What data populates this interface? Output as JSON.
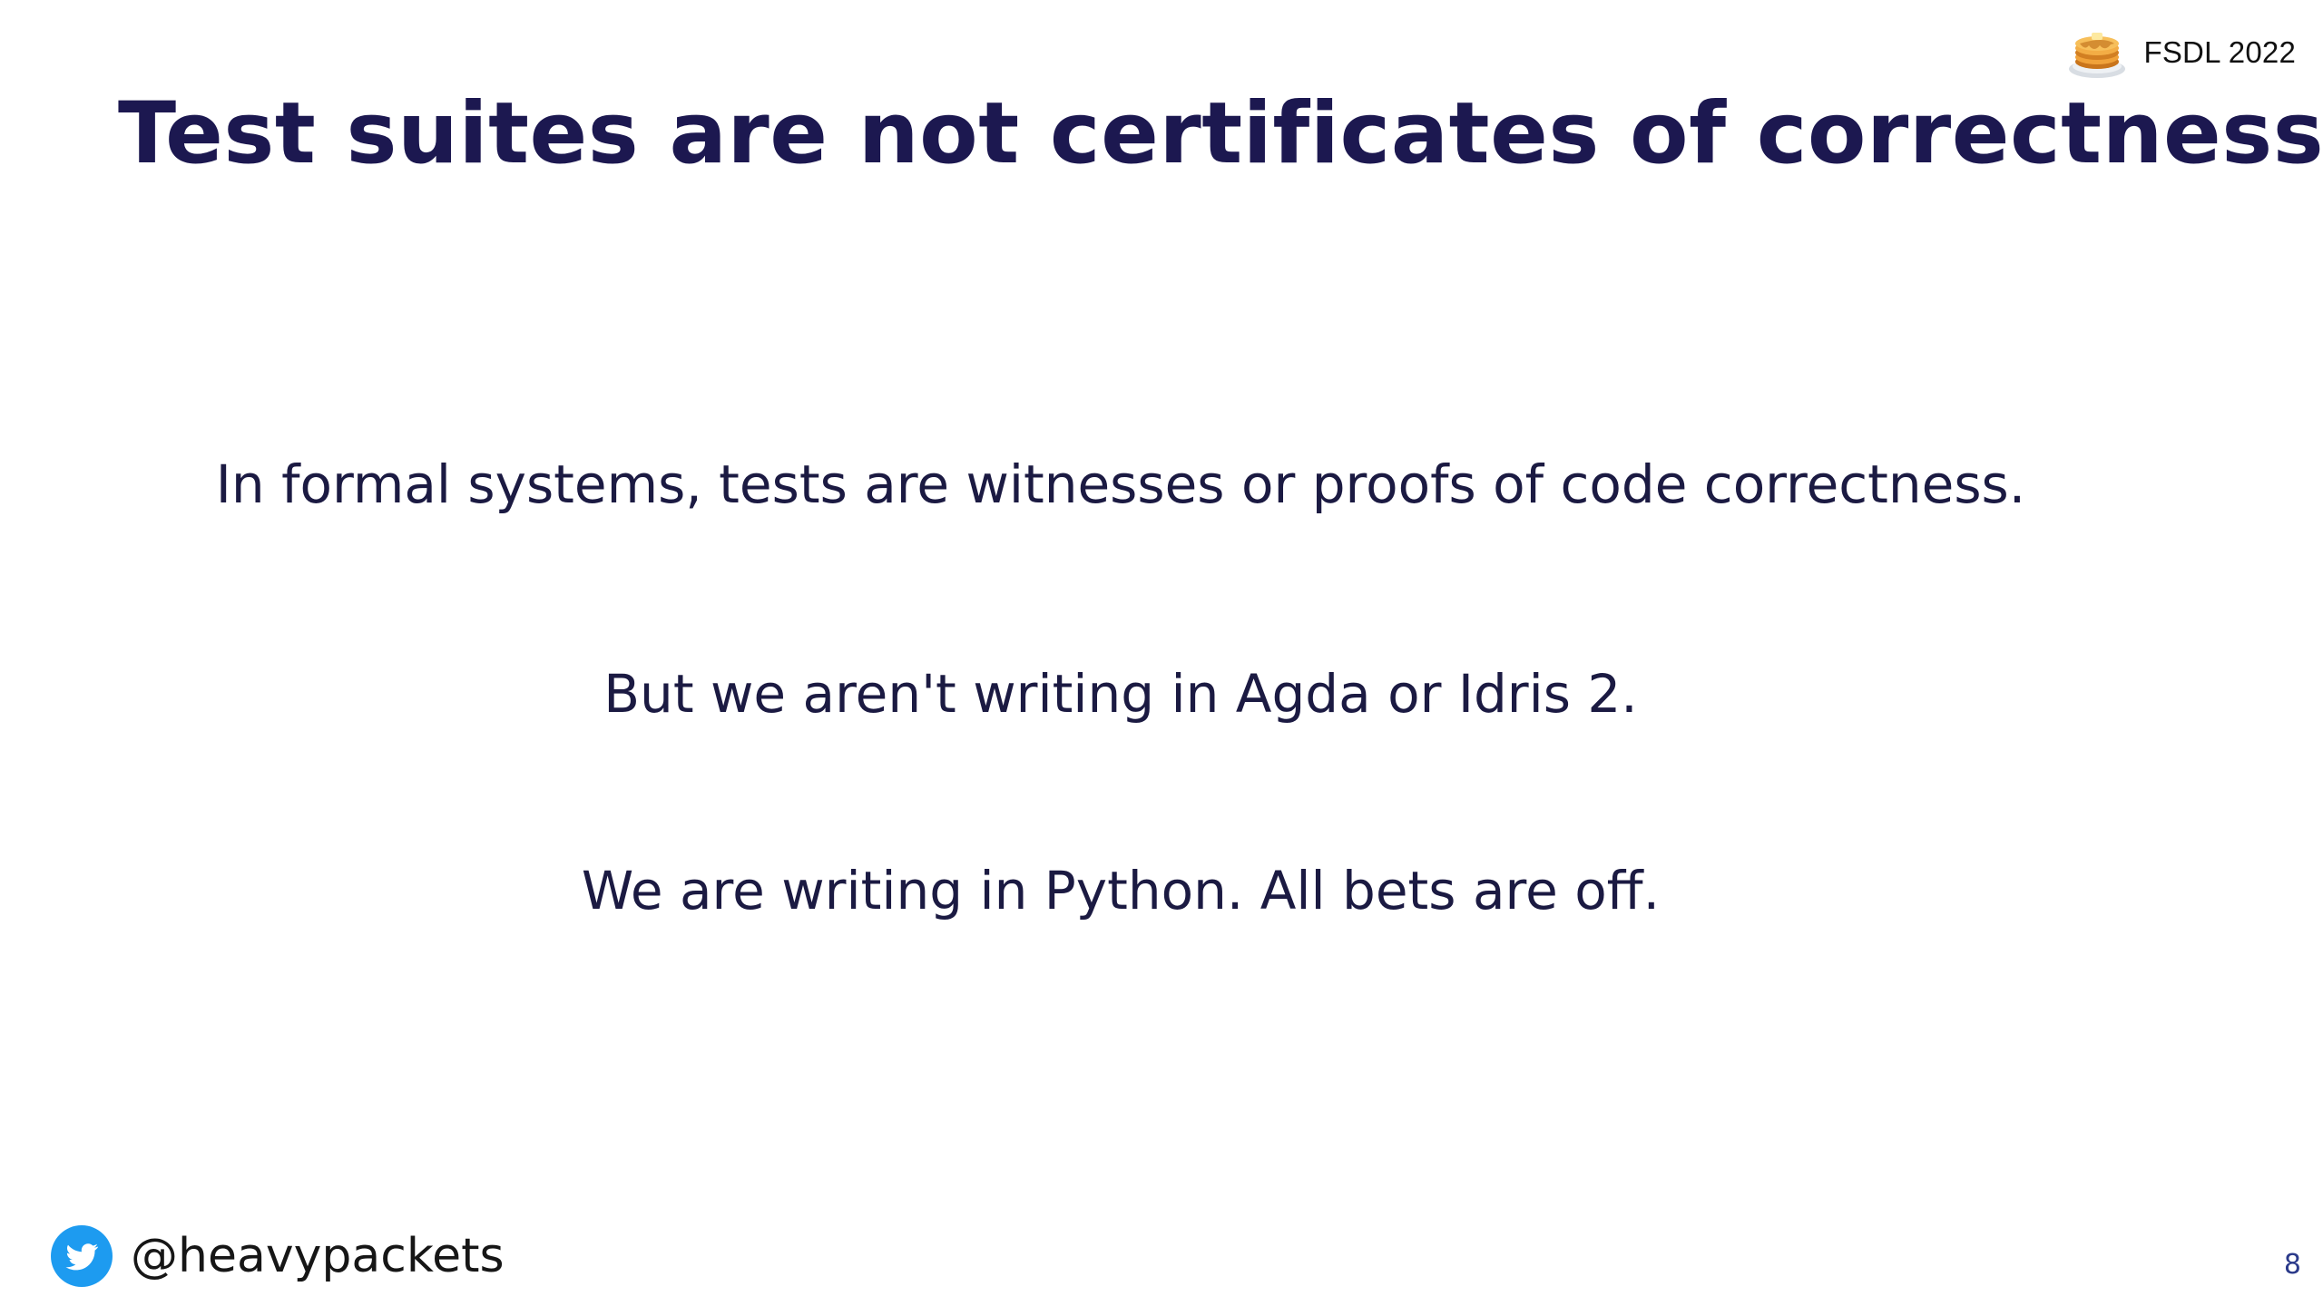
{
  "header": {
    "brand_label": "FSDL 2022",
    "brand_icon": "pancakes-icon"
  },
  "slide": {
    "title": "Test suites are not certificates of correctness.",
    "lines": [
      "In formal systems, tests are witnesses or proofs of code correctness.",
      "But we aren't writing in Agda or Idris 2.",
      "We are writing in Python. All bets are off."
    ]
  },
  "footer": {
    "twitter_icon": "twitter-icon",
    "handle": "@heavypackets",
    "page_number": "8"
  },
  "colors": {
    "title": "#1c1850",
    "body": "#1b1a42",
    "twitter": "#1d9bf0",
    "page_number": "#2b3a8a"
  }
}
